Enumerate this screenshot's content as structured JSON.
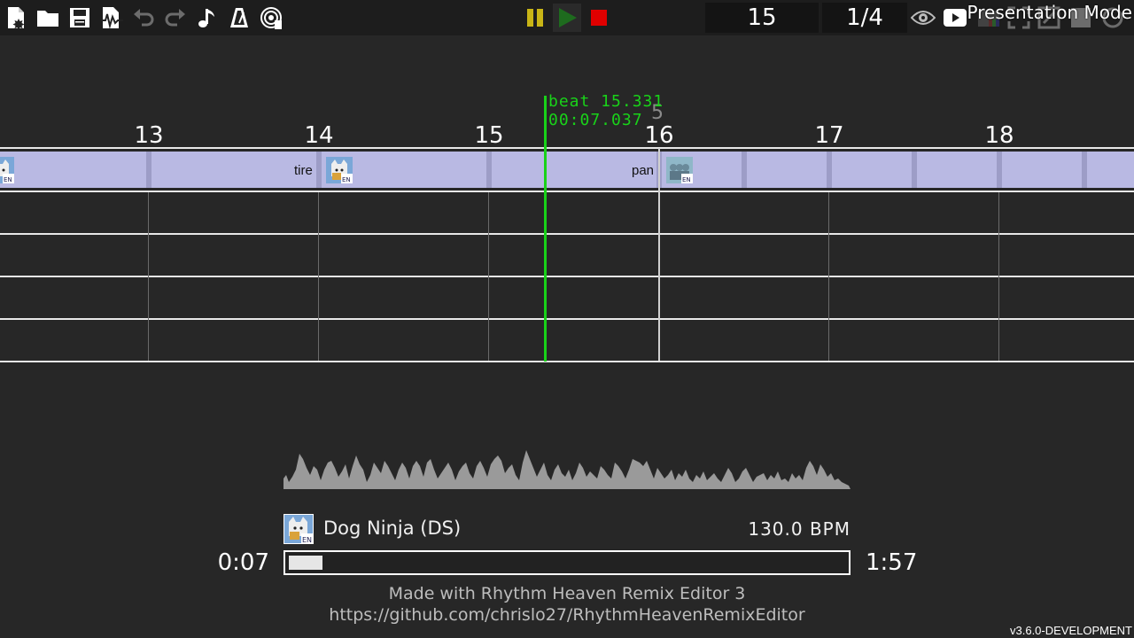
{
  "toolbar": {
    "left_icons": [
      "new-file-icon",
      "open-folder-icon",
      "save-icon",
      "export-audio-icon",
      "undo-icon",
      "redo-icon",
      "music-note-icon",
      "metronome-icon",
      "broadcast-icon"
    ],
    "center_icons": [
      "pause-icon",
      "play-icon",
      "stop-icon"
    ],
    "colors": {
      "pause": "#c9b516",
      "play": "#1e6b1e",
      "stop": "#e00000"
    },
    "beat_readout": "15",
    "snap_readout": "1/4",
    "presentation_label": "Presentation Mode"
  },
  "timeline": {
    "beat_numbers": [
      "13",
      "14",
      "15",
      "16",
      "17",
      "18"
    ],
    "playhead_beat": "beat 15.331",
    "playhead_time": "00:07.037",
    "ghost_digit": "5",
    "cue_labels": [
      "tire",
      "pan"
    ],
    "playhead_color": "#19d219",
    "cue_block_color": "#b9b9e3"
  },
  "song": {
    "game_name": "Dog Ninja (DS)",
    "bpm": "130.0 BPM",
    "time_current": "0:07",
    "time_total": "1:57",
    "progress": 0.06
  },
  "credits": {
    "line1": "Made with Rhythm Heaven Remix Editor 3",
    "line2": "https://github.com/chrislo27/RhythmHeavenRemixEditor"
  },
  "version": "v3.6.0-DEVELOPMENT"
}
